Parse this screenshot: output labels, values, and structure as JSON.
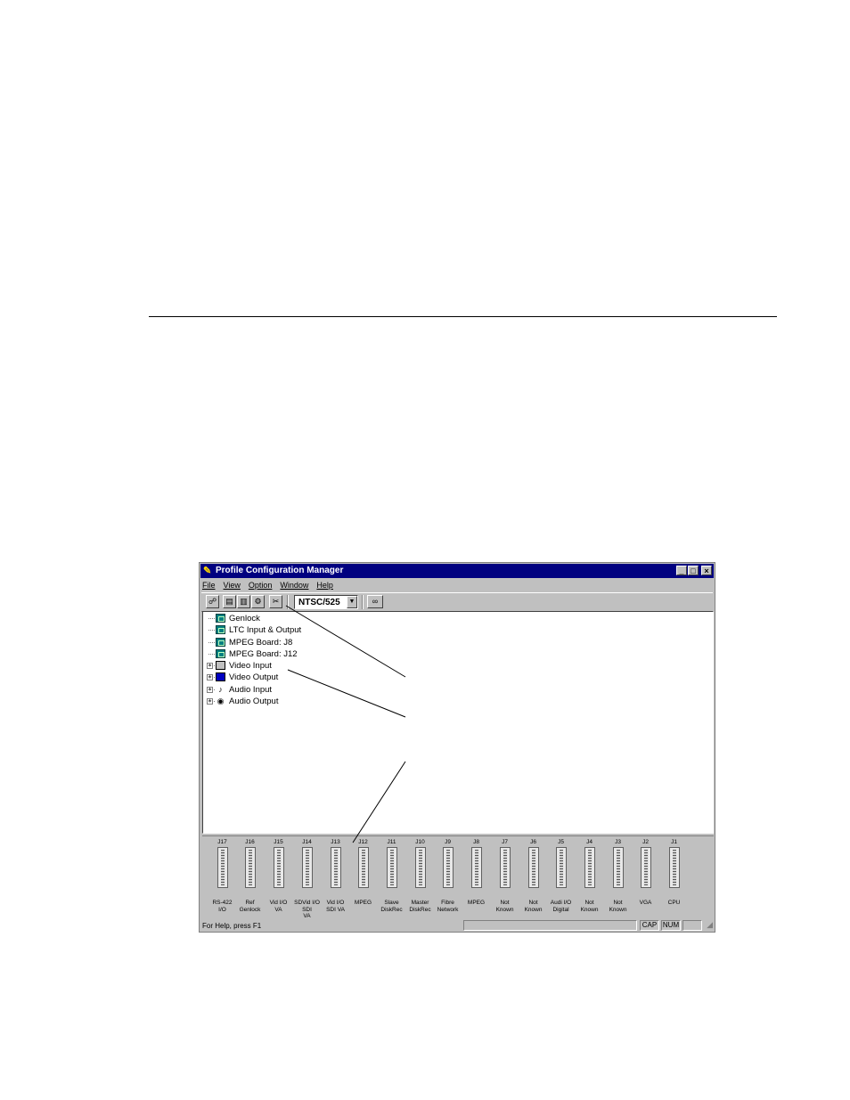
{
  "window": {
    "title": "Profile Configuration Manager",
    "minimize": "_",
    "maximize": "□",
    "close": "×"
  },
  "menu": [
    "File",
    "View",
    "Option",
    "Window",
    "Help"
  ],
  "toolbar": {
    "standard_value": "NTSC/525",
    "icons": [
      "open-icon",
      "board-icon",
      "board-config-icon",
      "settings-icon",
      "tools-icon",
      "binoculars-icon"
    ]
  },
  "tree": [
    {
      "label": "Genlock",
      "icon": "board-icon",
      "expandable": false
    },
    {
      "label": "LTC Input & Output",
      "icon": "board-icon",
      "expandable": false
    },
    {
      "label": "MPEG Board: J8",
      "icon": "board-icon",
      "expandable": false
    },
    {
      "label": "MPEG Board: J12",
      "icon": "board-icon",
      "expandable": false
    },
    {
      "label": "Video Input",
      "icon": "video-input-icon",
      "expandable": true
    },
    {
      "label": "Video Output",
      "icon": "video-output-icon",
      "expandable": true
    },
    {
      "label": "Audio Input",
      "icon": "audio-input-icon",
      "expandable": true
    },
    {
      "label": "Audio Output",
      "icon": "audio-output-icon",
      "expandable": true
    }
  ],
  "slots": [
    {
      "j": "J17",
      "label": "RS-422\nI/O"
    },
    {
      "j": "J16",
      "label": "Ref\nGenlock"
    },
    {
      "j": "J15",
      "label": "Vid I/O\nVA"
    },
    {
      "j": "J14",
      "label": "SDVid I/O SDI\nVA"
    },
    {
      "j": "J13",
      "label": "Vid I/O\nSDI VA"
    },
    {
      "j": "J12",
      "label": "MPEG"
    },
    {
      "j": "J11",
      "label": "Slave\nDiskRec"
    },
    {
      "j": "J10",
      "label": "Master\nDiskRec"
    },
    {
      "j": "J9",
      "label": "Fibre\nNetwork"
    },
    {
      "j": "J8",
      "label": "MPEG"
    },
    {
      "j": "J7",
      "label": "Not\nKnown"
    },
    {
      "j": "J6",
      "label": "Not\nKnown"
    },
    {
      "j": "J5",
      "label": "Audi I/O\nDigital"
    },
    {
      "j": "J4",
      "label": "Not\nKnown"
    },
    {
      "j": "J3",
      "label": "Not\nKnown"
    },
    {
      "j": "J2",
      "label": "VGA"
    },
    {
      "j": "J1",
      "label": "CPU"
    }
  ],
  "status": {
    "message": "For Help, press F1",
    "cap": "CAP",
    "num": "NUM"
  }
}
